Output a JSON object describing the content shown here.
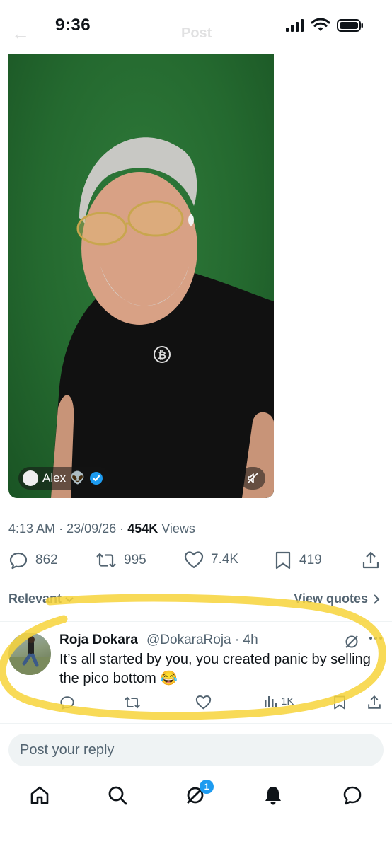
{
  "status_bar": {
    "time": "9:36"
  },
  "header": {
    "back_glyph": "←",
    "title": "Post"
  },
  "video": {
    "author_name": "Alex",
    "author_emoji": "👽",
    "verified": true
  },
  "post_meta": {
    "time": "4:13 AM",
    "date": "23/09/26",
    "separator": "·",
    "views_count": "454K",
    "views_label": "Views"
  },
  "actions": {
    "replies": "862",
    "reposts": "995",
    "likes": "7.4K",
    "bookmarks": "419"
  },
  "sort": {
    "label": "Relevant",
    "view_quotes": "View quotes"
  },
  "reply": {
    "name": "Roja Dokara",
    "handle": "@DokaraRoja",
    "time": "· 4h",
    "text": "It’s all started by you, you created panic by selling the pico bottom 😂",
    "views": "1K"
  },
  "composer": {
    "placeholder": "Post your reply"
  },
  "nav": {
    "badge": "1"
  },
  "colors": {
    "accent": "#1d9bf0",
    "highlight": "#f7d33a",
    "video_bg": "#24692f"
  }
}
